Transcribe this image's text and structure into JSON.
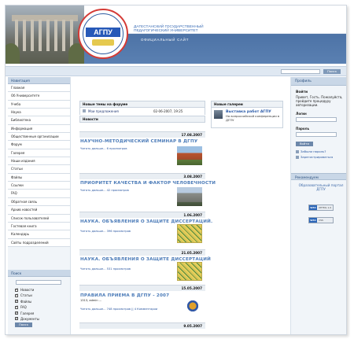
{
  "header": {
    "logo_text": "АГПУ",
    "university_name_line1": "ДАГЕСТАНСКИЙ ГОСУДАРСТВЕННЫЙ",
    "university_name_line2": "ПЕДАГОГИЧЕСКИЙ УНИВЕРСИТЕТ",
    "site_label": "ОФИЦИАЛЬНЫЙ САЙТ"
  },
  "top_search": {
    "button_label": "Поиск"
  },
  "navigation": {
    "title": "Навигация",
    "items": [
      "Главная",
      "Об Университете",
      "Учеба",
      "Наука",
      "Библиотека",
      "Информация",
      "Общественные организации",
      "Форум",
      "Галерея",
      "Наши издания",
      "Статьи",
      "Файлы",
      "Ссылки",
      "FAQ",
      "Обратная связь",
      "Архив новостей",
      "Список пользователей",
      "Гостевая книга",
      "Календарь",
      "Сайты подразделений"
    ]
  },
  "search": {
    "title": "Поиск",
    "options": [
      "Новости",
      "Статьи",
      "Файлы",
      "FAQ",
      "Галерея",
      "Документы"
    ],
    "button_label": "Поиск"
  },
  "forum": {
    "title": "Новые темы на форуме",
    "topic": "Мои предложения",
    "date": "02-06-2007, 19:25"
  },
  "gallery": {
    "title": "Новые галереи",
    "item_title": "Выставка работ АГПУ",
    "item_desc": "На всероссийской конференции в ДГПУ"
  },
  "news": {
    "title": "Новости",
    "items": [
      {
        "date": "17.08.2007",
        "title": "НАУЧНО-МЕТОДИЧЕСКИЙ СЕМИНАР В ДГПУ",
        "more": "Читать дальше... 6 просмотров"
      },
      {
        "date": "3.08.2007",
        "title": "ПРИОРИТЕТ КАЧЕСТВА И ФАКТОР ЧЕЛОВЕЧНОСТИ",
        "more": "Читать дальше... 42 просмотров"
      },
      {
        "date": "1.06.2007",
        "title": "НАУКА. ОБЪЯВЛЕНИЯ О ЗАЩИТЕ ДИССЕРТАЦИЙ.",
        "more": "Читать дальше... 396 просмотров"
      },
      {
        "date": "21.05.2007",
        "title": "НАУКА. ОБЪЯВЛЕНИЯ О ЗАЩИТЕ ДИССЕРТАЦИЙ",
        "more": "Читать дальше... 531 просмотров"
      },
      {
        "date": "15.05.2007",
        "title": "ПРАВИЛА ПРИЕМА В ДГПУ - 2007",
        "meta": "1313, admin ...",
        "more": "Читать дальше... 748 просмотров || 4 Комментарии"
      },
      {
        "date": "9.05.2007",
        "title": "",
        "more": ""
      }
    ]
  },
  "profile": {
    "title": "Профиль",
    "login_title": "Войти",
    "greeting": "Привет, Гость. Пожалуйста, пройдите процедуру авторизации.",
    "login_label": "Логин",
    "password_label": "Пароль",
    "login_button": "Войти",
    "forgot_password": "Забыли пароль?",
    "register": "Зарегистрироваться"
  },
  "recommend": {
    "title": "Рекомендуем",
    "portal": "Образовательный портал ДГПУ",
    "badges": [
      {
        "left": "W3C",
        "right": "XHTML 1.0"
      },
      {
        "left": "W3C",
        "right": "CSS"
      }
    ]
  }
}
